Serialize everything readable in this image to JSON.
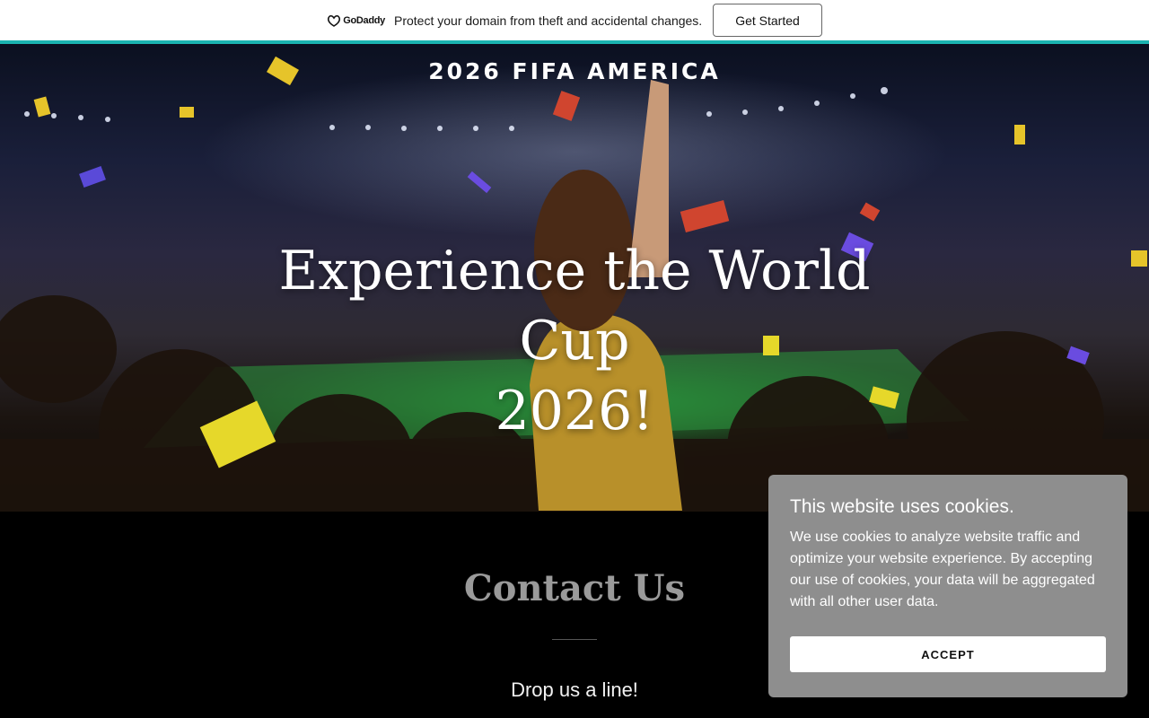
{
  "promo": {
    "logo_text": "GoDaddy",
    "message": "Protect your domain from theft and accidental changes.",
    "cta_label": "Get Started",
    "accent_color": "#1bb3b0"
  },
  "hero": {
    "site_title": "2026 FIFA AMERICA",
    "heading_line1": "Experience the World Cup",
    "heading_line2": "2026!"
  },
  "contact": {
    "title": "Contact Us",
    "subtitle": "Drop us a line!"
  },
  "cookie_banner": {
    "title": "This website uses cookies.",
    "body": "We use cookies to analyze website traffic and optimize your website experience. By accepting our use of cookies, your data will be aggregated with all other user data.",
    "accept_label": "ACCEPT",
    "background_color": "#8e8e8e"
  }
}
